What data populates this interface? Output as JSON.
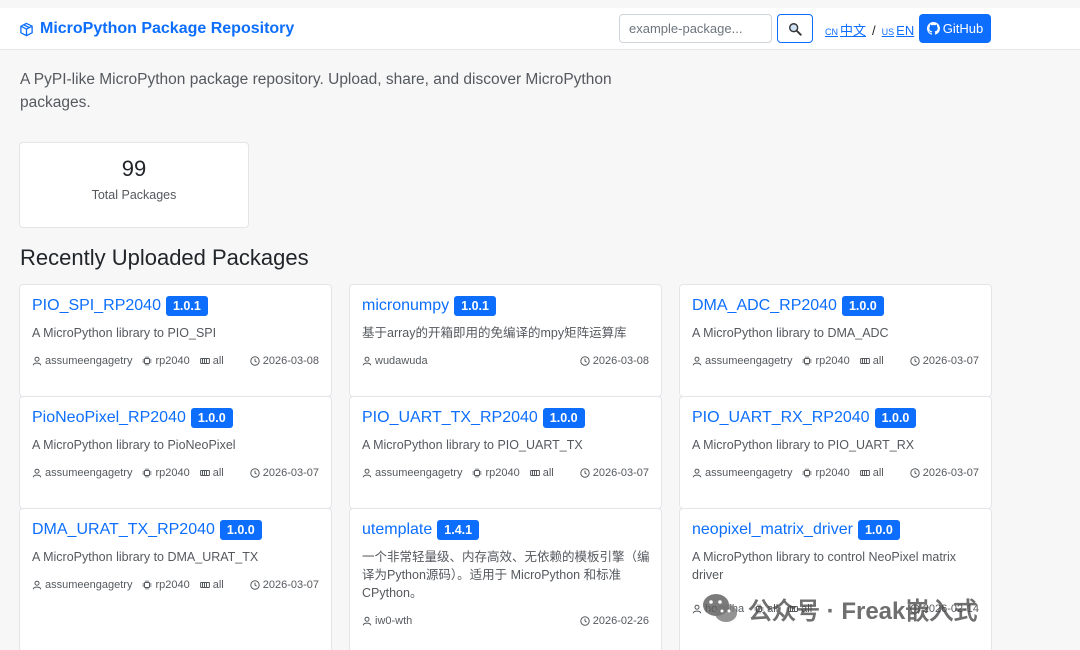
{
  "navbar": {
    "brand": "MicroPython Package Repository",
    "search_placeholder": "example-package...",
    "lang_cn_code": "CN",
    "lang_cn_label": "中文",
    "lang_sep": "/",
    "lang_en_code": "US",
    "lang_en_label": "EN",
    "github_label": "GitHub"
  },
  "intro": "A PyPI-like MicroPython package repository. Upload, share, and discover MicroPython packages.",
  "stats": {
    "count": "99",
    "label": "Total Packages"
  },
  "section_title": "Recently Uploaded Packages",
  "packages": [
    {
      "name": "PIO_SPI_RP2040",
      "version": "1.0.1",
      "description": "A MicroPython library to PIO_SPI",
      "author": "assumeengagetry",
      "chip": "rp2040",
      "board": "all",
      "date": "2026-03-08"
    },
    {
      "name": "micronumpy",
      "version": "1.0.1",
      "description": "基于array的开箱即用的免编译的mpy矩阵运算库",
      "author": "wudawuda",
      "date": "2026-03-08"
    },
    {
      "name": "DMA_ADC_RP2040",
      "version": "1.0.0",
      "description": "A MicroPython library to DMA_ADC",
      "author": "assumeengagetry",
      "chip": "rp2040",
      "board": "all",
      "date": "2026-03-07"
    },
    {
      "name": "PioNeoPixel_RP2040",
      "version": "1.0.0",
      "description": "A MicroPython library to PioNeoPixel",
      "author": "assumeengagetry",
      "chip": "rp2040",
      "board": "all",
      "date": "2026-03-07"
    },
    {
      "name": "PIO_UART_TX_RP2040",
      "version": "1.0.0",
      "description": "A MicroPython library to PIO_UART_TX",
      "author": "assumeengagetry",
      "chip": "rp2040",
      "board": "all",
      "date": "2026-03-07"
    },
    {
      "name": "PIO_UART_RX_RP2040",
      "version": "1.0.0",
      "description": "A MicroPython library to PIO_UART_RX",
      "author": "assumeengagetry",
      "chip": "rp2040",
      "board": "all",
      "date": "2026-03-07"
    },
    {
      "name": "DMA_URAT_TX_RP2040",
      "version": "1.0.0",
      "description": "A MicroPython library to DMA_URAT_TX",
      "author": "assumeengagetry",
      "chip": "rp2040",
      "board": "all",
      "date": "2026-03-07"
    },
    {
      "name": "utemplate",
      "version": "1.4.1",
      "description": "一个非常轻量级、内存高效、无依赖的模板引擎（编译为Python源码）。适用于 MicroPython 和标准 CPython。",
      "author": "iw0-wth",
      "date": "2026-02-26"
    },
    {
      "name": "neopixel_matrix_driver",
      "version": "1.0.0",
      "description": "A MicroPython library to control NeoPixel matrix driver",
      "author": "hogeiha",
      "chip": "all",
      "board": "all",
      "date": "2026-02-14"
    }
  ],
  "watermark": "公众号 · Freak嵌入式",
  "colors": {
    "accent": "#0d6efd",
    "background": "#f7f7f8",
    "card_border": "#e3e5e8",
    "muted_text": "#55595e"
  }
}
